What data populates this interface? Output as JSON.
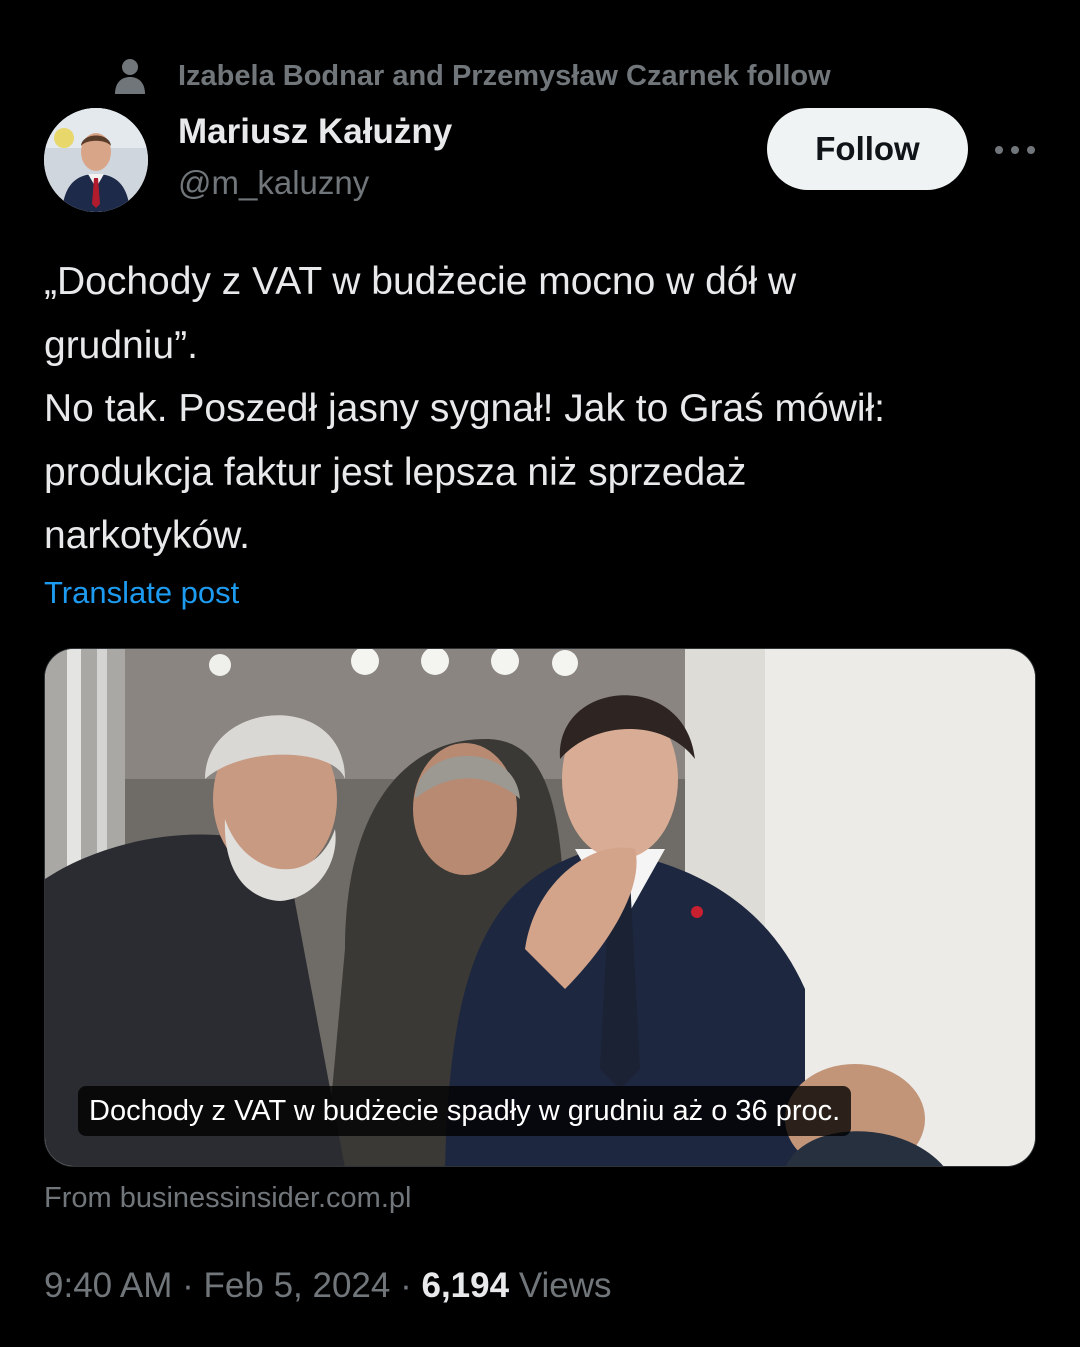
{
  "social_context": {
    "icon": "person-icon",
    "text": "Izabela Bodnar and Przemysław Czarnek follow"
  },
  "author": {
    "name": "Mariusz Kałużny",
    "handle": "@m_kaluzny"
  },
  "follow_button": {
    "label": "Follow"
  },
  "more_button": {
    "icon": "more-horizontal-icon"
  },
  "tweet": {
    "lines": [
      "„Dochody z VAT w budżecie mocno w dół w",
      "grudniu”.",
      "No tak. Poszedł jasny sygnał! Jak to Graś mówił:",
      "produkcja faktur jest lepsza niż sprzedaż",
      "narkotyków."
    ],
    "translate_label": "Translate post"
  },
  "media": {
    "caption": "Dochody z VAT w budżecie spadły w grudniu aż o 36 proc.",
    "source": "From businessinsider.com.pl"
  },
  "meta": {
    "time": "9:40 AM",
    "separator": "·",
    "date": "Feb 5, 2024",
    "views_count": "6,194",
    "views_label": "Views"
  },
  "colors": {
    "background": "#000000",
    "text_primary": "#e7e9ea",
    "text_secondary": "#71767b",
    "link": "#1d9bf0",
    "follow_bg": "#eff3f4"
  }
}
